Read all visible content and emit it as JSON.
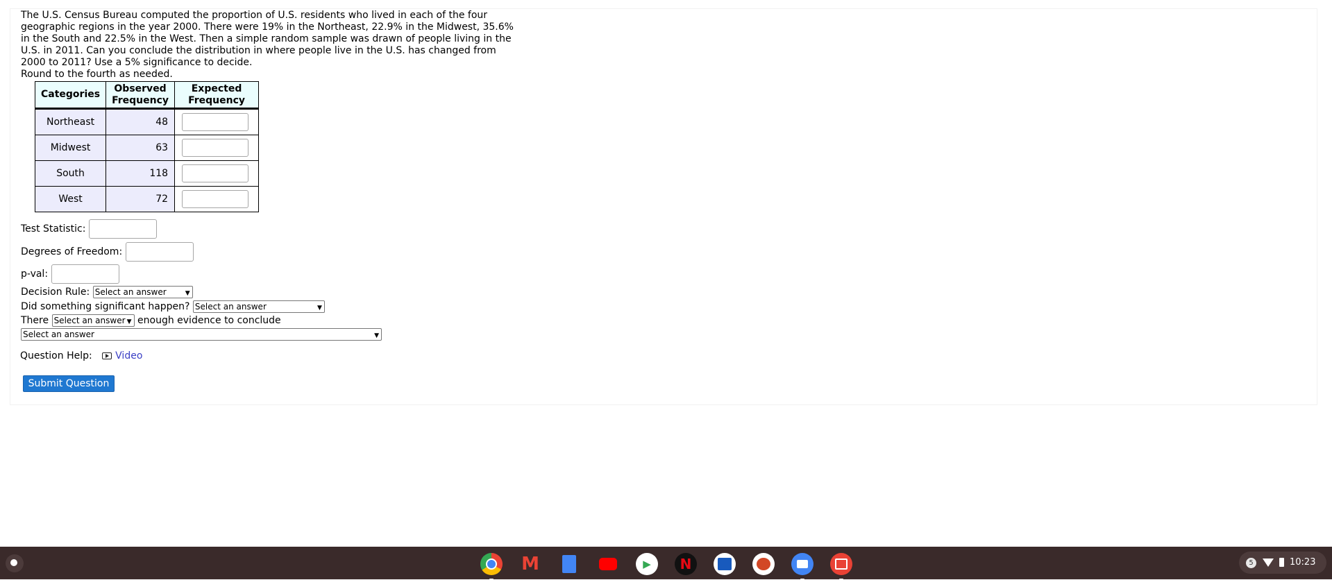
{
  "question": {
    "prompt": "The U.S. Census Bureau computed the proportion of U.S. residents who lived in each of the four geographic regions in the year 2000. There were 19% in the Northeast, 22.9% in the Midwest, 35.6% in the South and 22.5% in the West. Then a simple random sample was drawn of people living in the U.S. in 2011. Can you conclude the distribution in where people live in the U.S. has changed from 2000 to 2011? Use a 5% significance to decide.",
    "round_note": "Round to the fourth as needed."
  },
  "table": {
    "headers": [
      "Categories",
      "Observed Frequency",
      "Expected Frequency"
    ],
    "rows": [
      {
        "category": "Northeast",
        "observed": "48",
        "expected": ""
      },
      {
        "category": "Midwest",
        "observed": "63",
        "expected": ""
      },
      {
        "category": "South",
        "observed": "118",
        "expected": ""
      },
      {
        "category": "West",
        "observed": "72",
        "expected": ""
      }
    ]
  },
  "fields": {
    "test_statistic_label": "Test Statistic:",
    "test_statistic_value": "",
    "df_label": "Degrees of Freedom:",
    "df_value": "",
    "pval_label": "p-val:",
    "pval_value": ""
  },
  "selects": {
    "decision_rule_label": "Decision Rule:",
    "decision_rule_value": "Select an answer",
    "significant_label": "Did something significant happen?",
    "significant_value": "Select an answer",
    "there_label": "There",
    "there_value": "Select an answer",
    "evidence_label": "enough evidence to conclude",
    "conclusion_value": "Select an answer"
  },
  "help": {
    "label": "Question Help:",
    "video_label": "Video"
  },
  "submit_label": "Submit Question",
  "taskbar": {
    "apps": [
      "chrome-icon",
      "gmail-icon",
      "docs-icon",
      "youtube-icon",
      "play-store-icon",
      "netflix-icon",
      "word-icon",
      "powerpoint-icon",
      "files-icon",
      "gallery-icon"
    ],
    "notification_count": "5",
    "time": "10:23"
  }
}
